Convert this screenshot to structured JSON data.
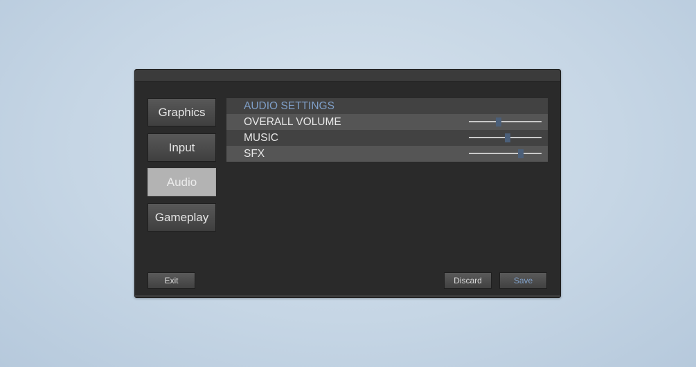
{
  "nav": {
    "items": [
      {
        "label": "Graphics",
        "active": false
      },
      {
        "label": "Input",
        "active": false
      },
      {
        "label": "Audio",
        "active": true
      },
      {
        "label": "Gameplay",
        "active": false
      }
    ]
  },
  "settings": {
    "header": "AUDIO SETTINGS",
    "rows": [
      {
        "label": "OVERALL VOLUME",
        "value": 0.41
      },
      {
        "label": "MUSIC",
        "value": 0.53
      },
      {
        "label": "SFX",
        "value": 0.71
      }
    ]
  },
  "footer": {
    "exit_label": "Exit",
    "discard_label": "Discard",
    "save_label": "Save"
  },
  "colors": {
    "accent": "#7f9fc8",
    "thumb": "#4b5f79",
    "window_bg": "#2a2a2a"
  }
}
